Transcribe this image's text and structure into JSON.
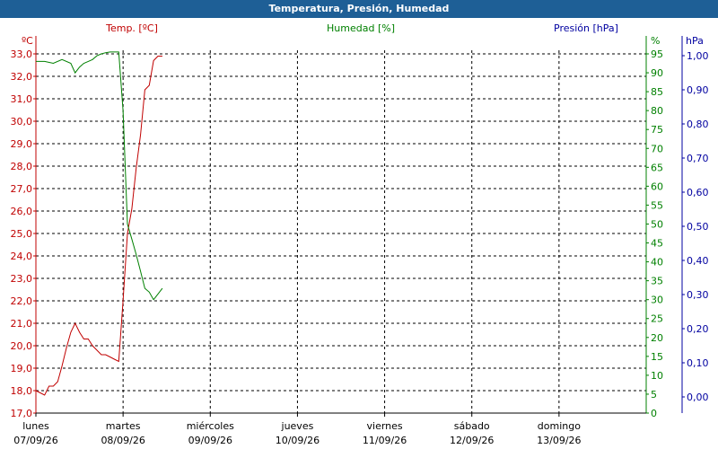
{
  "window": {
    "title": "Temperatura, Presión, Humedad"
  },
  "chart_data": {
    "type": "line",
    "title": "Temperatura, Presión, Humedad",
    "axes": {
      "temperature": {
        "label": "Temp. [ºC]",
        "unit": "ºC",
        "range": [
          17.0,
          33.0
        ],
        "step": 1.0,
        "color": "#c00000",
        "decimals": 1
      },
      "humidity": {
        "label": "Humedad [%]",
        "unit": "%",
        "range": [
          0,
          95
        ],
        "step": 5,
        "color": "#008000",
        "decimals": 0
      },
      "pressure": {
        "label": "Presión [hPa]",
        "unit": "hPa",
        "ticks": [
          "0,00",
          "0,10",
          "0,20",
          "0,30",
          "0,40",
          "0,50",
          "0,60",
          "0,70",
          "0,80",
          "0,90",
          "1,00"
        ],
        "tick_values": [
          0.0,
          0.1,
          0.2,
          0.3,
          0.4,
          0.5,
          0.6,
          0.7,
          0.8,
          0.9,
          1.0
        ],
        "color": "#0000a0"
      }
    },
    "x_axis": {
      "range_days": [
        0,
        7
      ],
      "categories": [
        {
          "day": "lunes",
          "date": "07/09/26"
        },
        {
          "day": "martes",
          "date": "08/09/26"
        },
        {
          "day": "miércoles",
          "date": "09/09/26"
        },
        {
          "day": "jueves",
          "date": "10/09/26"
        },
        {
          "day": "viernes",
          "date": "11/09/26"
        },
        {
          "day": "sábado",
          "date": "12/09/26"
        },
        {
          "day": "domingo",
          "date": "13/09/26"
        }
      ]
    },
    "grid": true,
    "series": [
      {
        "name": "Temp. [ºC]",
        "axis": "temperature",
        "color": "#c00000",
        "x": [
          0.0,
          0.05,
          0.1,
          0.15,
          0.2,
          0.25,
          0.3,
          0.35,
          0.4,
          0.45,
          0.5,
          0.55,
          0.6,
          0.65,
          0.7,
          0.75,
          0.8,
          0.85,
          0.9,
          0.95,
          1.0,
          1.05,
          1.1,
          1.15,
          1.2,
          1.25,
          1.3,
          1.35,
          1.4,
          1.45,
          1.5
        ],
        "y": [
          18.0,
          17.9,
          17.8,
          18.2,
          18.2,
          18.4,
          19.1,
          19.9,
          20.6,
          21.0,
          20.6,
          20.3,
          20.3,
          20.0,
          19.8,
          19.6,
          19.6,
          19.5,
          19.4,
          19.3,
          22.0,
          25.0,
          26.1,
          27.9,
          29.4,
          31.4,
          31.6,
          32.7,
          32.9,
          32.9,
          null
        ]
      },
      {
        "name": "Humedad [%]",
        "axis": "humidity",
        "color": "#008000",
        "x": [
          0.0,
          0.1,
          0.2,
          0.3,
          0.4,
          0.45,
          0.5,
          0.55,
          0.6,
          0.65,
          0.7,
          0.75,
          0.8,
          0.85,
          0.9,
          0.95,
          1.0,
          1.05,
          1.1,
          1.15,
          1.2,
          1.25,
          1.3,
          1.35,
          1.4,
          1.45,
          1.5
        ],
        "y": [
          93.0,
          93.0,
          92.5,
          93.5,
          92.5,
          90.0,
          91.5,
          92.5,
          93.0,
          93.5,
          94.5,
          95.0,
          95.3,
          95.5,
          95.5,
          95.5,
          80.0,
          50.0,
          46.0,
          42.0,
          37.5,
          33.0,
          32.0,
          30.0,
          31.5,
          33.0,
          null
        ]
      }
    ]
  }
}
